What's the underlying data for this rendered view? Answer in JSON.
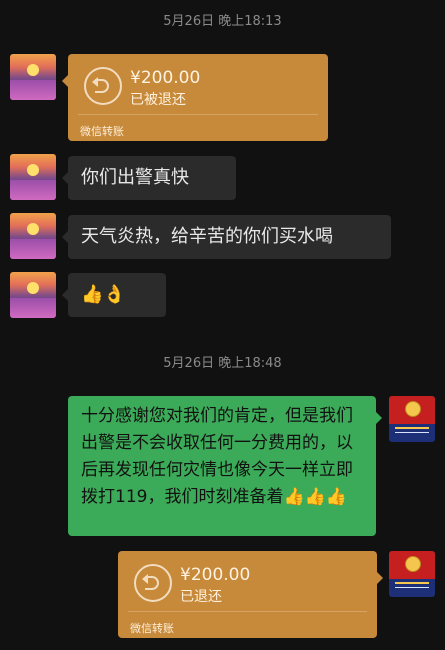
{
  "conversation": {
    "timestamps": [
      "5月26日 晚上18:13",
      "5月26日 晚上18:48"
    ],
    "incoming_transfer": {
      "amount": "¥200.00",
      "status": "已被退还",
      "footer": "微信转账"
    },
    "incoming_messages": [
      "你们出警真快",
      "天气炎热，给辛苦的你们买水喝",
      "👍👌"
    ],
    "reply_message": "十分感谢您对我们的肯定，但是我们出警是不会收取任何一分费用的，以后再发现任何灾情也像今天一样立即拨打119，我们时刻准备着👍👍👍",
    "outgoing_transfer": {
      "amount": "¥200.00",
      "status": "已退还",
      "footer": "微信转账"
    }
  },
  "icons": {
    "avatar_left": "sunset-flowers-avatar",
    "avatar_right": "fire-rescue-emblem-avatar",
    "transfer_icon": "return-arrow-icon"
  },
  "colors": {
    "background": "#111111",
    "incoming_bubble": "#2b2b2b",
    "outgoing_bubble": "#3cab59",
    "transfer_card": "#c7893a"
  }
}
